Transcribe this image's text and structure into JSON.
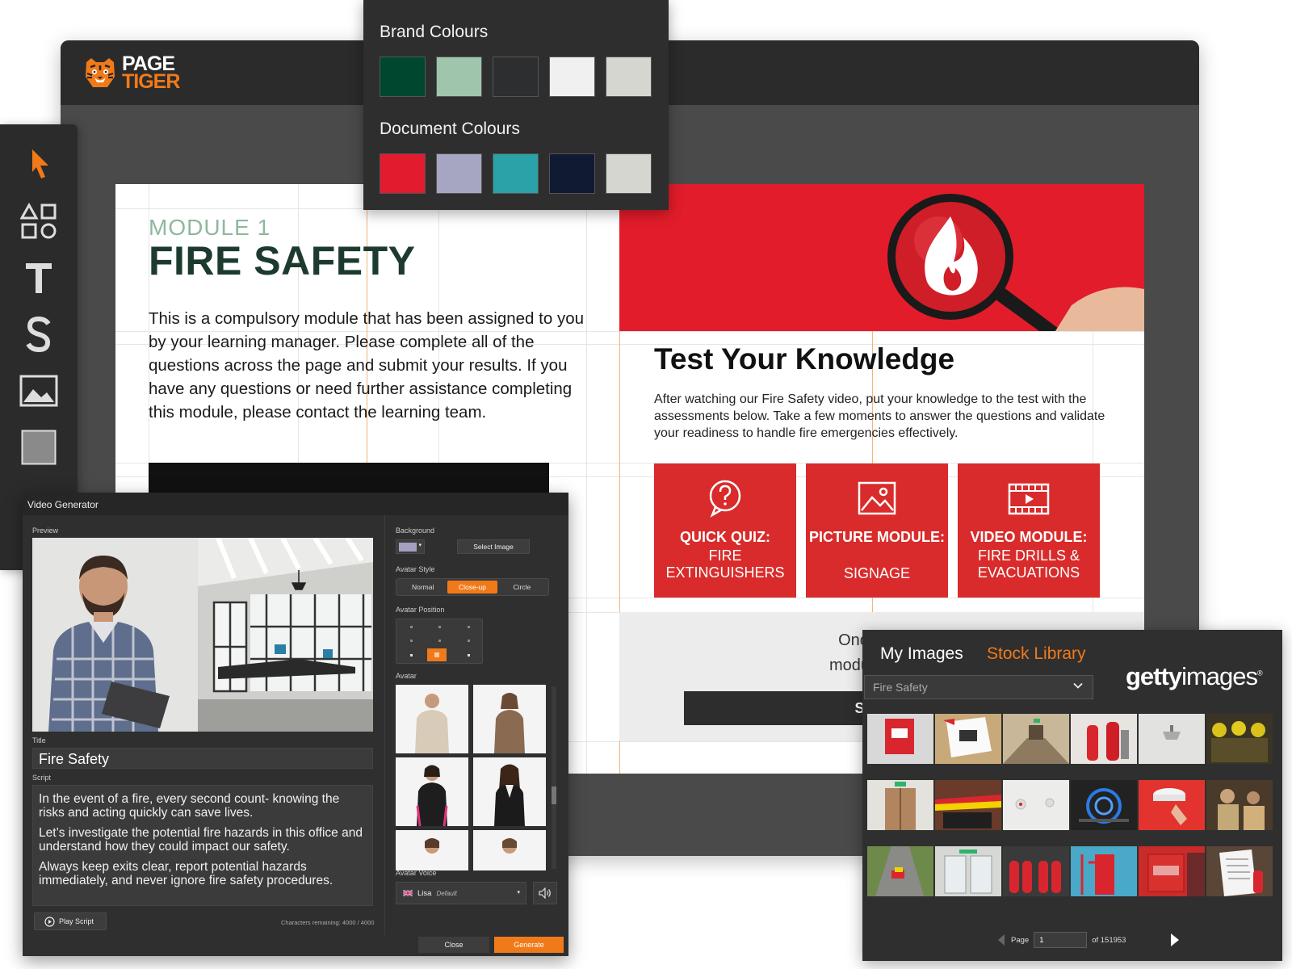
{
  "app": {
    "logo_line1": "PAGE",
    "logo_line2": "TIGER",
    "accent": "#f07a1a"
  },
  "toolbar": {
    "tools": [
      "pointer-icon",
      "shapes-icon",
      "text-icon",
      "style-icon",
      "image-icon",
      "rectangle-icon"
    ]
  },
  "colours": {
    "brand_label": "Brand Colours",
    "brand": [
      "#00472f",
      "#9fc5ad",
      "#2d2e30",
      "#f0f0f0",
      "#d6d6d1"
    ],
    "document_label": "Document Colours",
    "document": [
      "#e31b2e",
      "#a7a6c2",
      "#2aa2a8",
      "#101a33",
      "#d6d6d1"
    ]
  },
  "document": {
    "module_label": "MODULE 1",
    "module_title": "FIRE SAFETY",
    "intro": "This is a compulsory module that has been assigned to you by your learning manager. Please complete all of the questions across the page and submit your results. If you have any questions or need further assistance completing this module, please contact the learning team.",
    "test_title": "Test Your Knowledge",
    "test_body": "After watching our Fire Safety video, put your knowledge to the test with the assessments below. Take a few moments to answer the questions and validate your readiness to handle fire emergencies effectively.",
    "tiles": [
      {
        "head": "QUICK QUIZ:",
        "sub": "FIRE EXTINGUISHERS",
        "icon": "question-bubble-icon"
      },
      {
        "head": "PICTURE MODULE:",
        "sub": "SIGNAGE",
        "icon": "picture-icon"
      },
      {
        "head": "VIDEO MODULE:",
        "sub": "FIRE DRILLS & EVACUATIONS",
        "icon": "video-icon"
      }
    ],
    "submit_text_line1": "Once you have cor",
    "submit_text_line2": "modules, please click",
    "submit_label": "SUBM"
  },
  "video_generator": {
    "title": "Video Generator",
    "preview_label": "Preview",
    "title_label": "Title",
    "title_value": "Fire Safety",
    "script_label": "Script",
    "script": [
      "In the event of a fire, every second count- knowing the risks and acting quickly can save lives.",
      "Let’s investigate the potential fire hazards in this office and understand how they could impact our safety.",
      "Always keep exits clear, report potential hazards immediately, and never ignore fire safety procedures."
    ],
    "play_label": "Play Script",
    "chars_remaining": "Characters remaining: 4000 / 4000",
    "background_label": "Background",
    "background_color": "#a3a0c2",
    "select_image_label": "Select Image",
    "avatar_style_label": "Avatar Style",
    "styles": [
      "Normal",
      "Close-up",
      "Circle"
    ],
    "selected_style": "Close-up",
    "avatar_position_label": "Avatar Position",
    "avatar_label": "Avatar",
    "voice_label": "Avatar Voice",
    "voice_name": "Lisa",
    "voice_default": "Default",
    "close_label": "Close",
    "generate_label": "Generate"
  },
  "images_panel": {
    "tab_my": "My Images",
    "tab_stock": "Stock Library",
    "provider_bold": "getty",
    "provider_light": "images",
    "provider_mark": "®",
    "search_value": "Fire Safety",
    "page_label": "Page",
    "page_value": "1",
    "page_total": "of 151953"
  }
}
